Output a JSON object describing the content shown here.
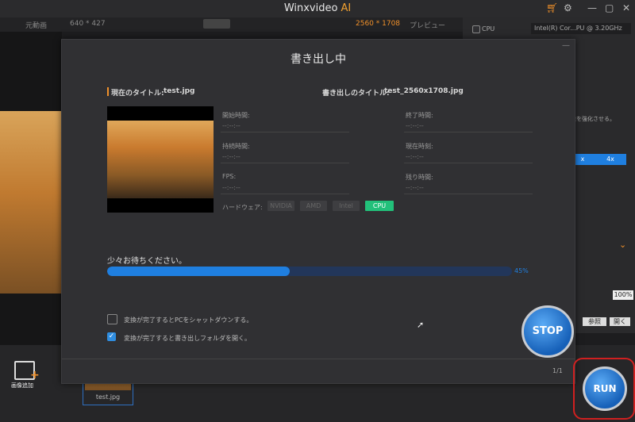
{
  "window": {
    "title": "Winxvideo",
    "title_suffix": "AI"
  },
  "toolbar": {
    "source_tab": "元動画",
    "source_res": "640 * 427",
    "output_res": "2560 * 1708",
    "preview_tab": "プレビュー"
  },
  "right_panel": {
    "cpu_label": "CPU",
    "cpu_select": "Intel(R) Cor...PU @ 3.20GHz",
    "enhance_text": "像を強化させる。",
    "scale_2x": "x",
    "scale_4x": "4x",
    "percent": "100%",
    "browse": "参照",
    "open": "開く"
  },
  "modal": {
    "title": "書き出し中",
    "current_title_label": "現在のタイトル:",
    "current_title_value": "test.jpg",
    "output_title_label": "書き出しのタイトル:",
    "output_title_value": "test_2560x1708.jpg",
    "fields": {
      "start_time": {
        "label": "開始時間:",
        "value": "--:--:--"
      },
      "end_time": {
        "label": "終了時間:",
        "value": "--:--:--"
      },
      "elapsed": {
        "label": "持続時間:",
        "value": "--:--:--"
      },
      "current_time": {
        "label": "現在時刻:",
        "value": "--:--:--"
      },
      "fps": {
        "label": "FPS:",
        "value": "--:--:--"
      },
      "remaining": {
        "label": "残り時間:",
        "value": "--:--:--"
      }
    },
    "hardware_label": "ハードウェア:",
    "hardware": [
      "NVIDIA",
      "AMD",
      "Intel",
      "CPU"
    ],
    "hardware_active": "CPU",
    "wait_text": "少々お待ちください。",
    "progress": 0.45,
    "progress_text": "45%",
    "opt_shutdown": "変換が完了するとPCをシャットダウンする。",
    "opt_shutdown_checked": false,
    "opt_open_folder": "変換が完了すると書き出しフォルダを開く。",
    "opt_open_folder_checked": true,
    "stop_label": "STOP",
    "page_counter": "1/1"
  },
  "bottom": {
    "add_image_label": "画像追加",
    "thumb_name": "test.jpg",
    "run_label": "RUN"
  },
  "colors": {
    "accent_orange": "#f0902a",
    "progress_blue": "#1f7fe0",
    "cpu_green": "#22c07a",
    "run_border": "#d02020"
  },
  "icons": [
    "cart-icon",
    "gear-icon",
    "minimize-icon",
    "maximize-icon",
    "close-icon",
    "add-image-icon",
    "chevron-down-icon",
    "mouse-cursor-icon"
  ]
}
